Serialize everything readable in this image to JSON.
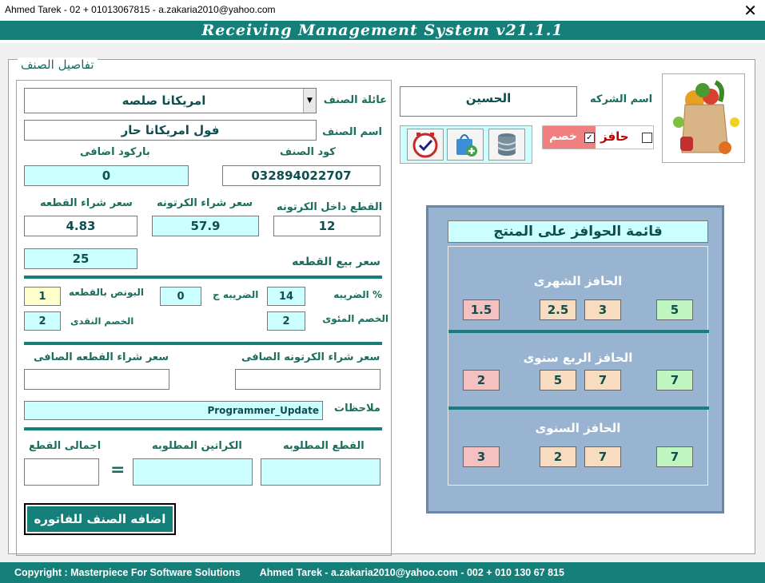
{
  "window": {
    "title": "Ahmed Tarek - 02 + 01013067815 - a.zakaria2010@yahoo.com",
    "close": "✕"
  },
  "app_title": "Receiving Management System v21.1.1",
  "group_title": "تفاصيل الصنف",
  "item": {
    "family_label": "عائلة الصنف",
    "family_value": "امريكانا صلصه",
    "name_label": "اسم الصنف",
    "name_value": "فول امريكانا حار",
    "code_label": "كود الصنف",
    "code_value": "032894022707",
    "extra_barcode_label": "باركود اضافى",
    "extra_barcode_value": "0",
    "pieces_per_carton_label": "القطع داخل الكرتونه",
    "pieces_per_carton_value": "12",
    "carton_buy_label": "سعر شراء الكرتونه",
    "carton_buy_value": "57.9",
    "piece_buy_label": "سعر شراء القطعه",
    "piece_buy_value": "4.83",
    "piece_sell_label": "سعر بيع القطعه",
    "piece_sell_value": "25",
    "tax_pct_label": "الضريبه %",
    "tax_pct_value": "14",
    "tax_fixed_label": "الضريبه ج",
    "tax_fixed_value": "0",
    "bonus_label": "البونص بالقطعه",
    "bonus_value": "1",
    "discount_pct_label": "الخصم المئوى",
    "discount_pct_value": "2",
    "discount_cash_label": "الخصم النقدى",
    "discount_cash_value": "2",
    "net_carton_label": "سعر شراء الكرتونه الصافى",
    "net_carton_value": "",
    "net_piece_label": "سعر شراء القطعه الصافى",
    "net_piece_value": "",
    "notes_label": "ملاحظات",
    "notes_value": "Programmer_Update",
    "req_pieces_label": "القطع المطلوبه",
    "req_pieces_value": "",
    "req_cartons_label": "الكراتين المطلوبه",
    "req_cartons_value": "",
    "total_pieces_label": "اجمالى القطع",
    "total_pieces_value": "",
    "equals": "=",
    "add_button": "اضافه الصنف للفاتوره"
  },
  "company": {
    "label": "اسم الشركه",
    "value": "الحسين"
  },
  "toggles": {
    "incentive_label": "حافز",
    "discount_label": "خصم",
    "check_mark": "✓"
  },
  "icons": {
    "product": "grocery-bag-icon",
    "clock": "clock-check-icon",
    "bag": "shopping-bag-add-icon",
    "db": "database-icon"
  },
  "incentives": {
    "title": "قائمة الحوافز على المنتج",
    "sections": [
      {
        "name": "الحافز الشهرى",
        "values": [
          "1.5",
          "2.5",
          "3",
          "5"
        ]
      },
      {
        "name": "الحافز الربع سنوى",
        "values": [
          "2",
          "5",
          "7",
          "7"
        ]
      },
      {
        "name": "الحافز السنوى",
        "values": [
          "3",
          "2",
          "7",
          "7"
        ]
      }
    ]
  },
  "footer": {
    "copyright": "Copyright : Masterpiece For Software Solutions",
    "author": "Ahmed Tarek  -  a.zakaria2010@yahoo.com  -  002 + 010 130 67 815"
  },
  "colors": {
    "teal": "#157f79",
    "cyan": "#ccffff",
    "panel": "#99b4d1"
  }
}
